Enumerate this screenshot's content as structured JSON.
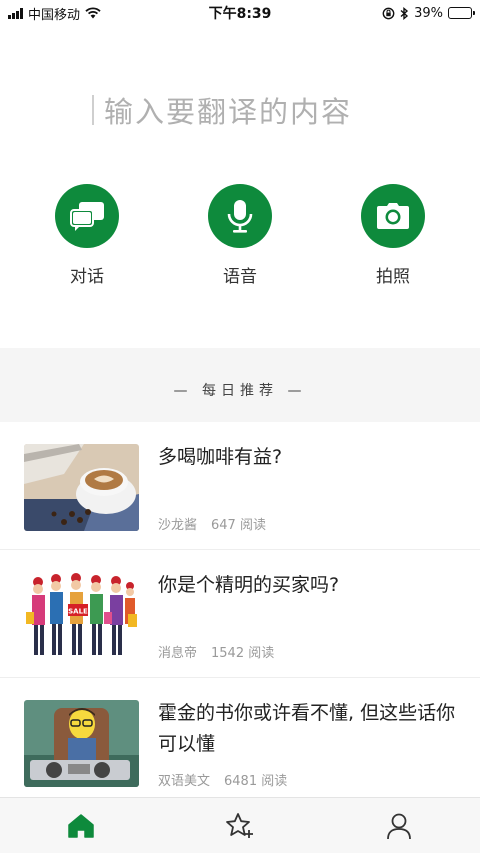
{
  "status_bar": {
    "carrier": "中国移动",
    "time": "下午8:39",
    "battery_percent": "39%",
    "battery_level": 0.39
  },
  "search": {
    "placeholder": "输入要翻译的内容"
  },
  "actions": [
    {
      "label": "对话",
      "icon": "chat-bubbles-icon"
    },
    {
      "label": "语音",
      "icon": "microphone-icon"
    },
    {
      "label": "拍照",
      "icon": "camera-icon"
    }
  ],
  "recommend": {
    "title": "— 每日推荐 —"
  },
  "articles": [
    {
      "title": "多喝咖啡有益?",
      "source": "沙龙酱",
      "reads": "647 阅读",
      "thumb": "coffee-cup"
    },
    {
      "title": "你是个精明的买家吗?",
      "source": "消息帝",
      "reads": "1542 阅读",
      "thumb": "shoppers-group",
      "thumb_text": "SALE"
    },
    {
      "title": "霍金的书你或许看不懂, 但这些话你可以懂",
      "source": "双语美文",
      "reads": "6481 阅读",
      "thumb": "cartoon-hawking"
    }
  ],
  "tabbar": [
    {
      "icon": "home-icon",
      "active": true,
      "color": "#0e8a3c"
    },
    {
      "icon": "star-plus-icon",
      "active": false
    },
    {
      "icon": "person-icon",
      "active": false
    }
  ],
  "colors": {
    "accent": "#0e8a3c",
    "background": "#f5f5f5"
  }
}
